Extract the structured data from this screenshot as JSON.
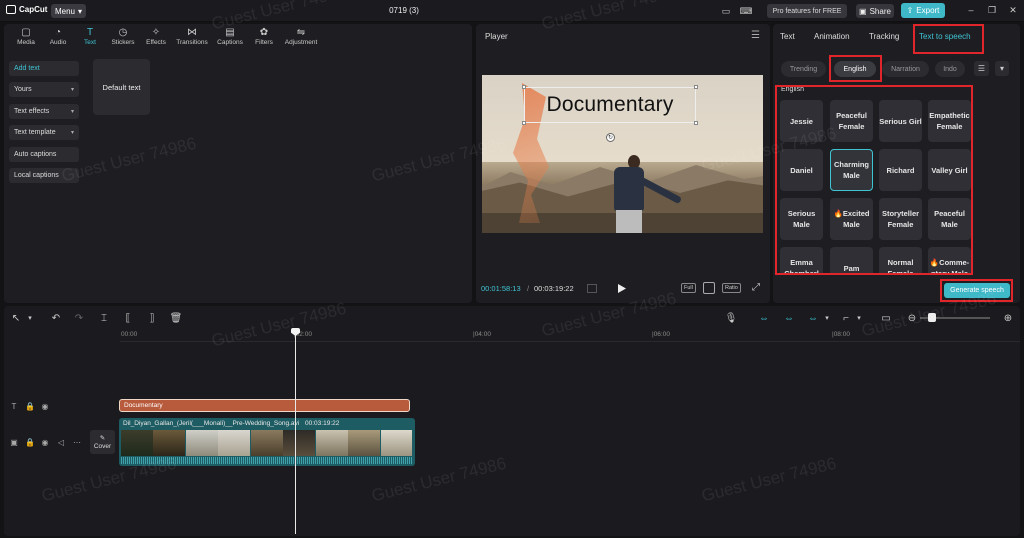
{
  "app": {
    "name": "CapCut",
    "menu_label": "Menu",
    "project_title": "0719 (3)",
    "pro_features_label": "Pro features for FREE",
    "share_label": "Share",
    "export_label": "Export"
  },
  "tools": {
    "tabs": [
      {
        "label": "Media",
        "icon": "media-icon"
      },
      {
        "label": "Audio",
        "icon": "audio-icon"
      },
      {
        "label": "Text",
        "icon": "text-icon",
        "active": true
      },
      {
        "label": "Stickers",
        "icon": "stickers-icon"
      },
      {
        "label": "Effects",
        "icon": "effects-icon"
      },
      {
        "label": "Transitions",
        "icon": "transitions-icon"
      },
      {
        "label": "Captions",
        "icon": "captions-icon"
      },
      {
        "label": "Filters",
        "icon": "filters-icon"
      },
      {
        "label": "Adjustment",
        "icon": "adjustment-icon"
      }
    ],
    "side_menu": [
      {
        "label": "Add text",
        "active": true
      },
      {
        "label": "Yours",
        "dropdown": true
      },
      {
        "label": "Text effects",
        "dropdown": true
      },
      {
        "label": "Text template",
        "dropdown": true
      },
      {
        "label": "Auto captions"
      },
      {
        "label": "Local captions"
      }
    ],
    "default_text_card": "Default text"
  },
  "player": {
    "title": "Player",
    "overlay_text": "Documentary",
    "current_time": "00:01:58:13",
    "separator": "/",
    "duration": "00:03:19:22",
    "full_label": "Full",
    "ratio_label": "Ratio"
  },
  "right_panel": {
    "tabs": [
      "Text",
      "Animation",
      "Tracking",
      "Text to speech"
    ],
    "active_tab": "Text to speech",
    "categories": [
      "Trending",
      "English",
      "Narration",
      "Indo"
    ],
    "active_category": "English",
    "section_label": "English",
    "voices": [
      {
        "label": "Jessie"
      },
      {
        "label": "Peaceful Female"
      },
      {
        "label": "Serious Girl"
      },
      {
        "label": "Empathetic Female"
      },
      {
        "label": "Daniel"
      },
      {
        "label": "Charming Male",
        "selected": true
      },
      {
        "label": "Richard"
      },
      {
        "label": "Valley Girl"
      },
      {
        "label": "Serious Male"
      },
      {
        "label": "🔥Excited Male"
      },
      {
        "label": "Storyteller Female"
      },
      {
        "label": "Peaceful Male"
      },
      {
        "label": "Emma Chamberl"
      },
      {
        "label": "Pam"
      },
      {
        "label": "Normal Female"
      },
      {
        "label": "🔥Comme-ntary Male"
      }
    ],
    "generate_label": "Generate speech"
  },
  "timeline": {
    "ruler": [
      "00:00",
      "|02:00",
      "|04:00",
      "|06:00",
      "|08:00"
    ],
    "text_clip_label": "Documentary",
    "video_clip_name": "Dil_Diyan_Gallan_(Jeril(___Monali)__Pre-Wedding_Song.avi",
    "video_clip_duration": "00:03:19:22",
    "cover_label": "Cover"
  },
  "watermark": "Guest User 74986",
  "colors": {
    "accent": "#3fb8c8",
    "highlight_box": "#e0262b",
    "text_clip": "#b85a3c",
    "video_clip": "#1e5c63"
  }
}
